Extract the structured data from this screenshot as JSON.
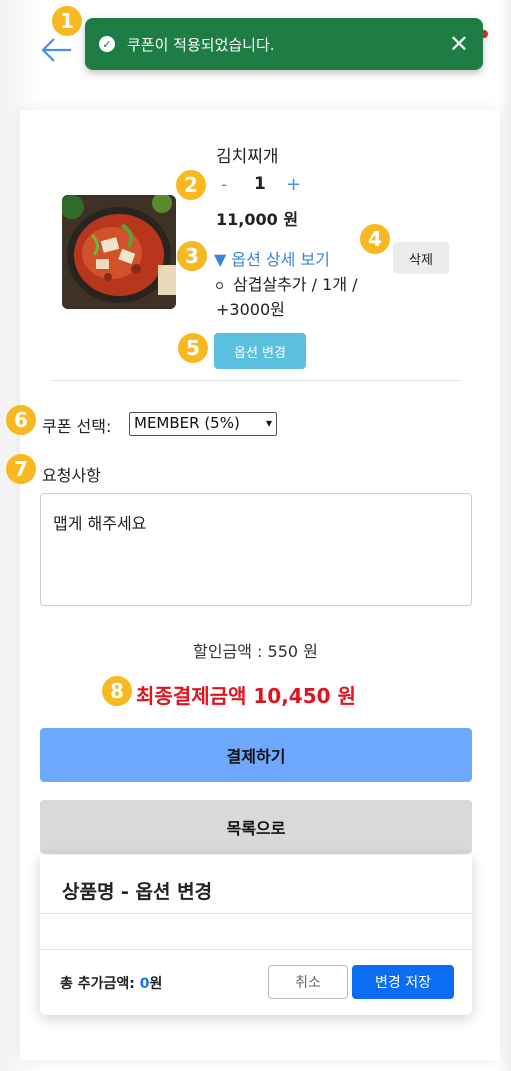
{
  "toast": {
    "message": "쿠폰이 적용되었습니다.",
    "color": "#1e7d45"
  },
  "badges": [
    "1",
    "2",
    "3",
    "4",
    "5",
    "6",
    "7",
    "8"
  ],
  "item": {
    "name": "김치찌개",
    "qty_minus": "-",
    "qty": "1",
    "qty_plus": "+",
    "price": "11,000 원",
    "option_toggle": "▼ 옵션 상세 보기",
    "delete_label": "삭제",
    "option_line": "삼겹살추가 / 1개 / +3000원",
    "option_change_label": "옵션 변경"
  },
  "coupon": {
    "label": "쿠폰 선택:",
    "selected": "MEMBER (5%)"
  },
  "request": {
    "label": "요청사항",
    "value": "맵게 해주세요"
  },
  "summary": {
    "discount": "할인금액 : 550 원",
    "final": "최종결제금액 10,450 원"
  },
  "actions": {
    "pay": "결제하기",
    "list": "목록으로"
  },
  "modal": {
    "title": "상품명 - 옵션 변경",
    "total_label": "총 추가금액: ",
    "total_value": "0",
    "total_unit": "원",
    "cancel": "취소",
    "save": "변경 저장"
  },
  "colors": {
    "accent_blue": "#4a90e2",
    "final_red": "#e0141e",
    "badge": "#f8b81f",
    "save_blue": "#0b6ef2"
  }
}
